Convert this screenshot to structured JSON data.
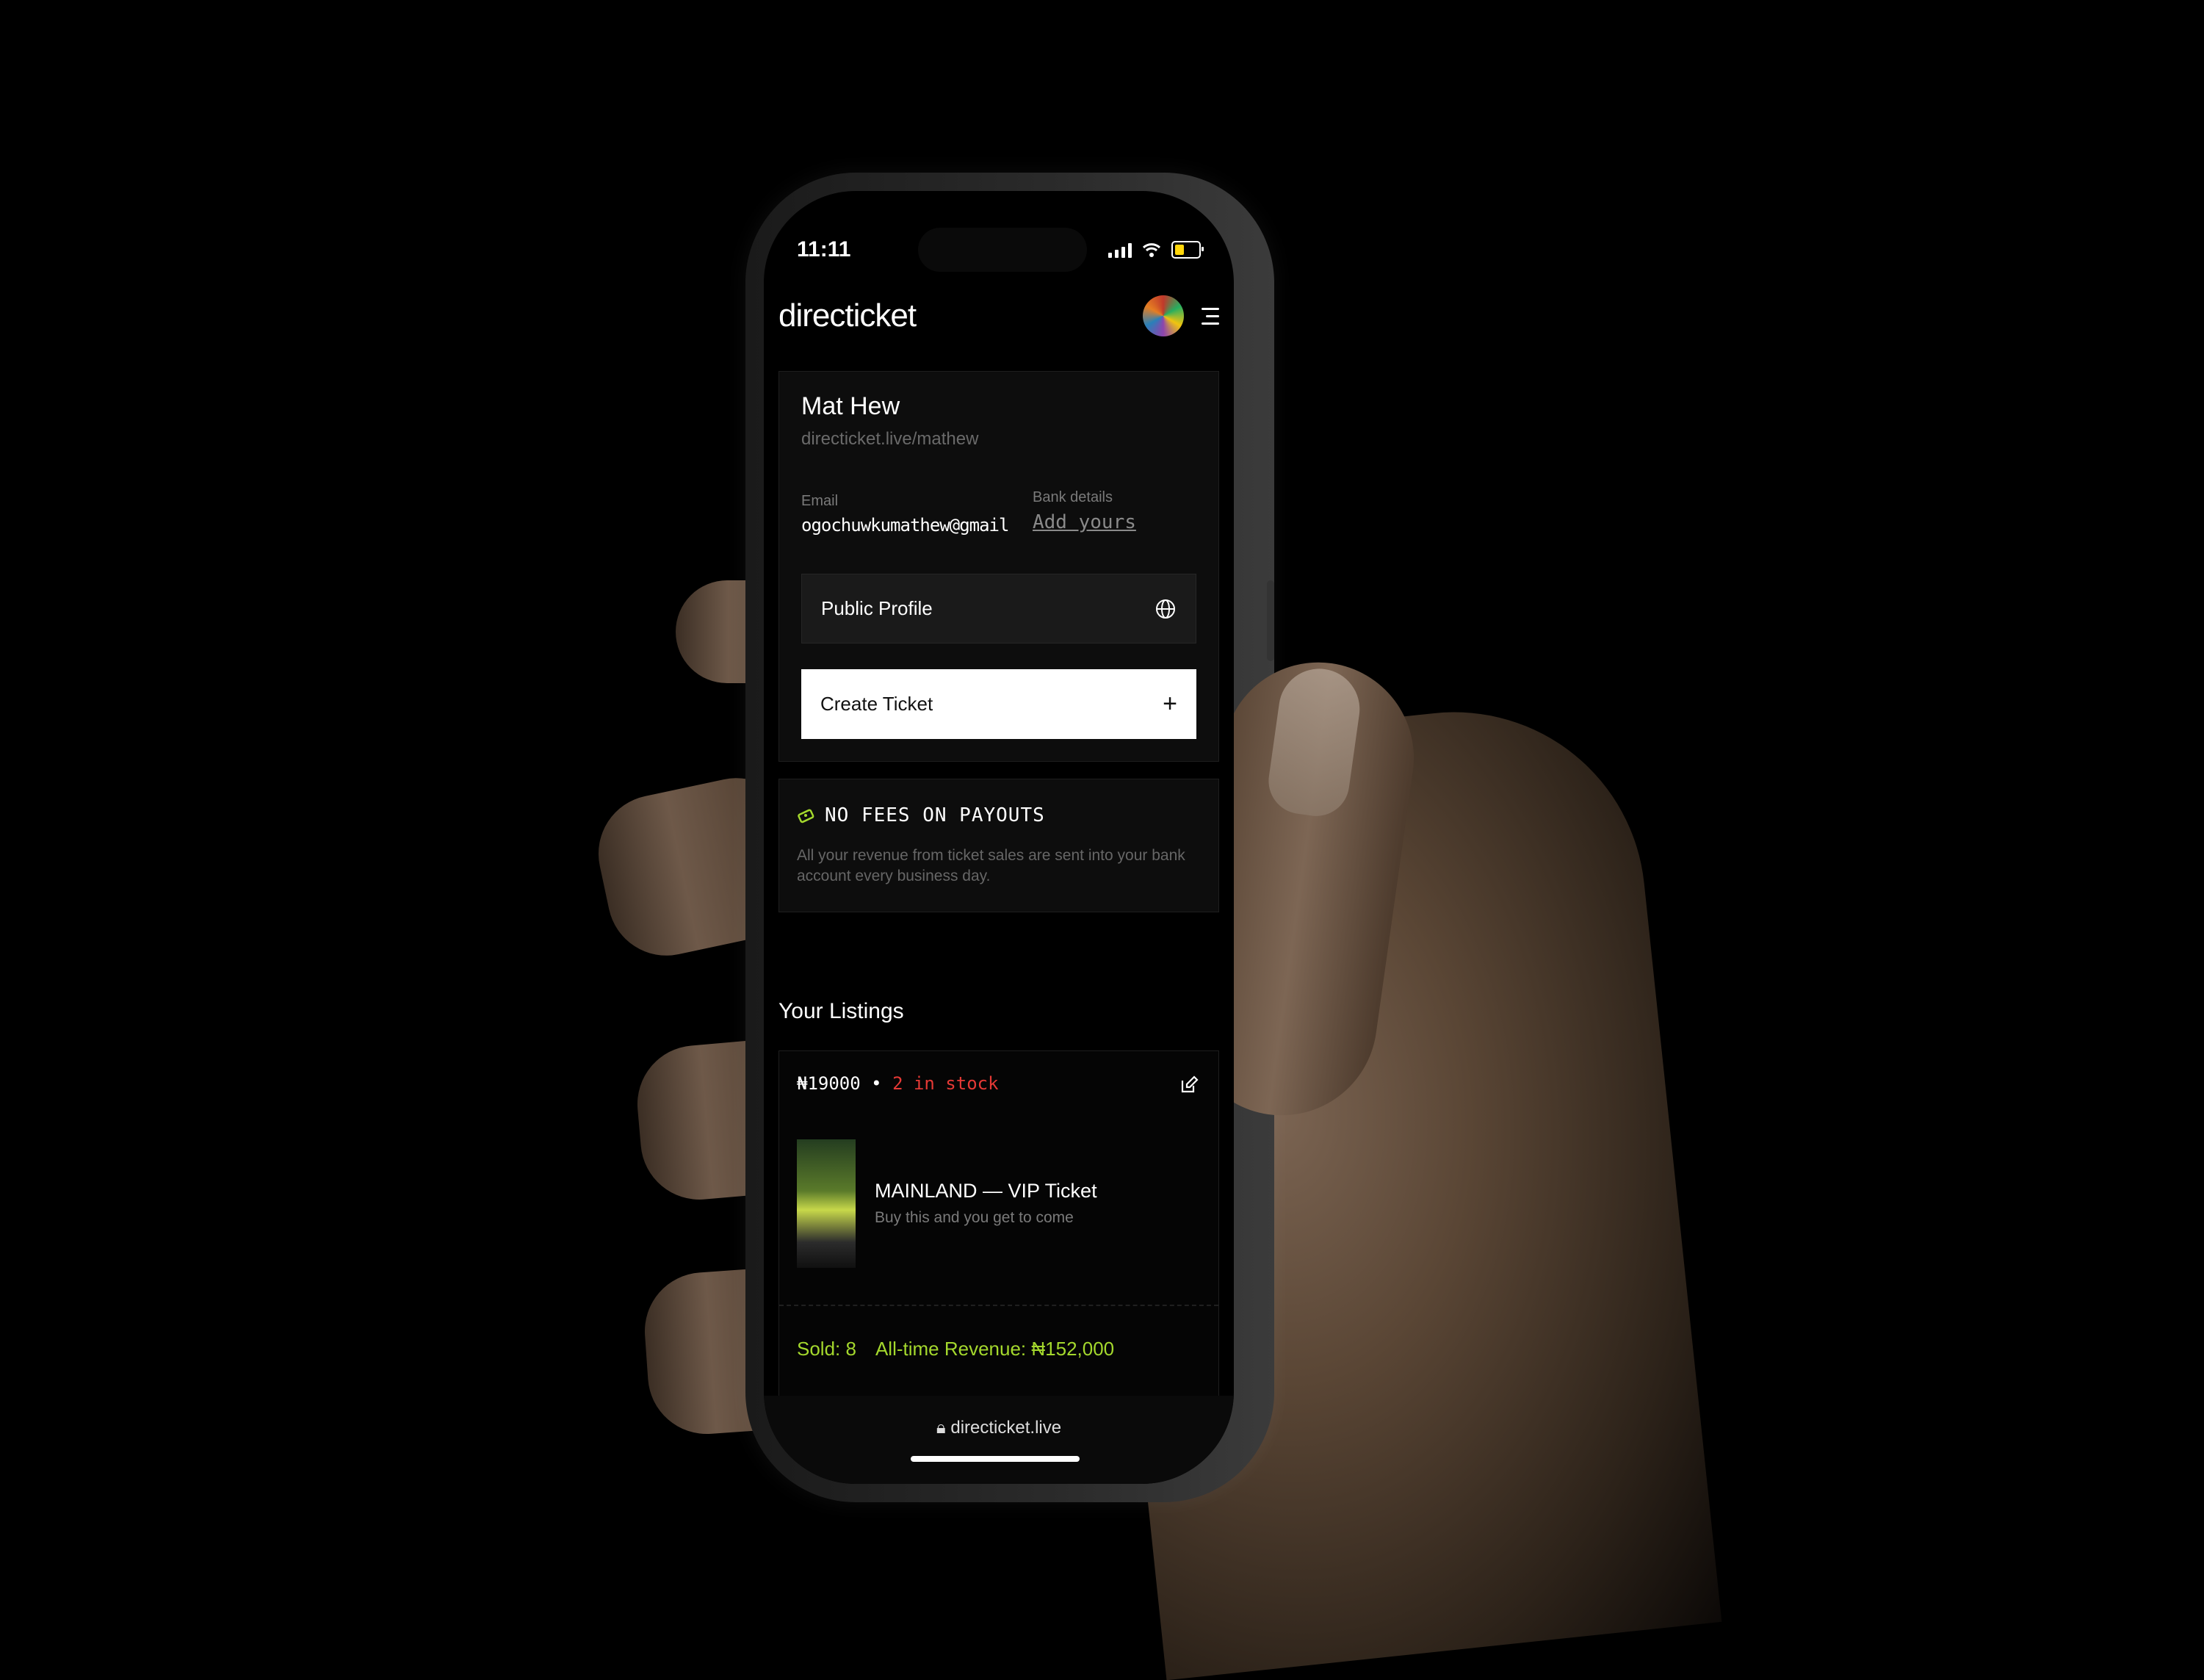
{
  "status_bar": {
    "time": "11:11"
  },
  "header": {
    "logo": "directicket"
  },
  "profile": {
    "name": "Mat Hew",
    "link": "directicket.live/mathew",
    "email_label": "Email",
    "email_value": "ogochuwkumathew@gmail",
    "bank_label": "Bank details",
    "bank_action": "Add yours",
    "public_profile_label": "Public Profile",
    "create_ticket_label": "Create Ticket"
  },
  "fees": {
    "title": "NO FEES ON PAYOUTS",
    "text": "All your revenue from ticket sales are sent into your bank account every business day."
  },
  "listings": {
    "title": "Your Listings",
    "items": [
      {
        "price": "₦19000",
        "separator": "•",
        "stock": "2 in stock",
        "name": "MAINLAND — VIP Ticket",
        "description": "Buy this and you get to come",
        "sold": "Sold: 8",
        "revenue": "All-time Revenue: ₦152,000"
      }
    ]
  },
  "browser": {
    "url": "directicket.live"
  },
  "colors": {
    "accent_green": "#a4d82d",
    "stock_red": "#e53935",
    "background": "#000000"
  }
}
